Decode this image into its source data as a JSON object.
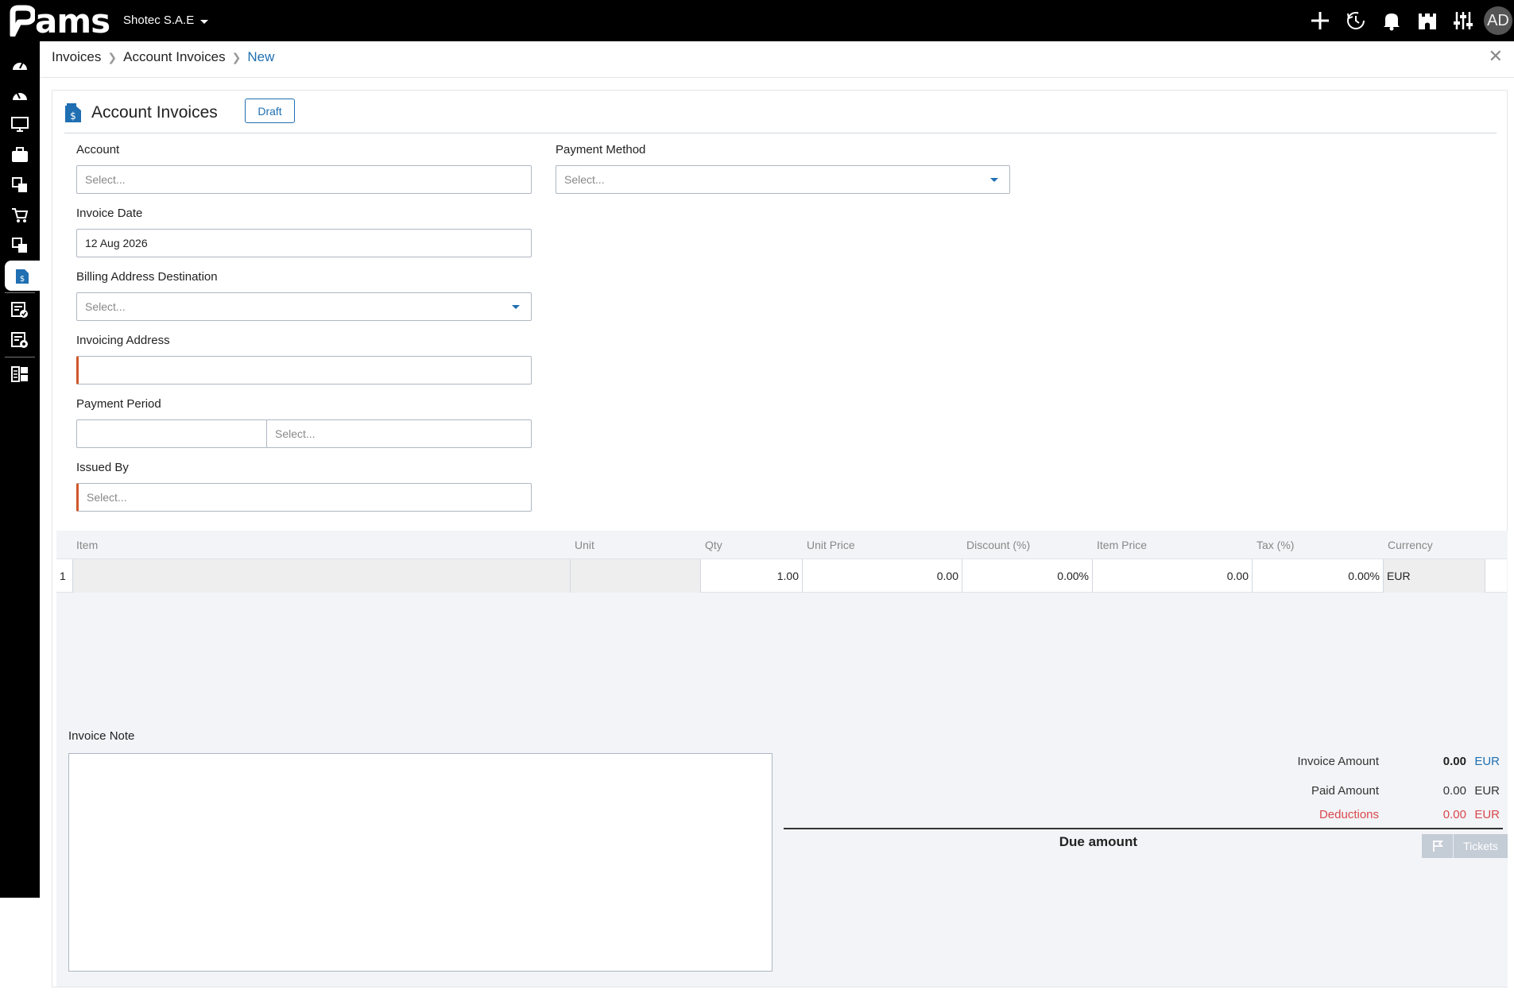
{
  "app": {
    "logo_text": "ams",
    "company": "Shotec S.A.E",
    "avatar_initials": "AD"
  },
  "topbar": {
    "icons": [
      "plus-icon",
      "history-icon",
      "bell-icon",
      "castle-icon",
      "sliders-icon"
    ]
  },
  "sidebar": {
    "items": [
      "dashboard-icon",
      "dashboard-alt-icon",
      "monitor-icon",
      "briefcase-icon",
      "documents-icon",
      "cart-icon",
      "documents-alt-icon",
      "invoice-icon",
      "checklist-icon",
      "settings-doc-icon",
      "grid-icon"
    ],
    "active_index": 7
  },
  "breadcrumb": {
    "items": [
      "Invoices",
      "Account Invoices",
      "New"
    ]
  },
  "form": {
    "title": "Account Invoices",
    "status": "Draft",
    "account": {
      "label": "Account",
      "placeholder": "Select..."
    },
    "payment_method": {
      "label": "Payment Method",
      "placeholder": "Select..."
    },
    "invoice_date": {
      "label": "Invoice Date",
      "value": "12 Aug 2026"
    },
    "billing_address": {
      "label": "Billing Address Destination",
      "placeholder": "Select..."
    },
    "invoicing_address": {
      "label": "Invoicing Address",
      "value": ""
    },
    "payment_period": {
      "label": "Payment Period",
      "value": "",
      "unit_placeholder": "Select..."
    },
    "issued_by": {
      "label": "Issued By",
      "placeholder": "Select..."
    }
  },
  "grid": {
    "headers": [
      "Item",
      "Unit",
      "Qty",
      "Unit Price",
      "Discount (%)",
      "Item Price",
      "Tax (%)",
      "Currency"
    ],
    "rows": [
      {
        "index": "1",
        "item": "",
        "unit": "",
        "qty": "1.00",
        "unit_price": "0.00",
        "discount": "0.00%",
        "item_price": "0.00",
        "tax": "0.00%",
        "currency": "EUR"
      }
    ]
  },
  "note": {
    "label": "Invoice Note",
    "value": ""
  },
  "summary": {
    "invoice_amount": {
      "label": "Invoice Amount",
      "value": "0.00",
      "currency": "EUR"
    },
    "paid_amount": {
      "label": "Paid Amount",
      "value": "0.00",
      "currency": "EUR"
    },
    "deductions": {
      "label": "Deductions",
      "value": "0.00",
      "currency": "EUR"
    },
    "due_label": "Due amount",
    "tickets_label": "Tickets"
  },
  "colors": {
    "accent": "#1f6fb2",
    "required": "#d0572a",
    "deduction": "#d9484d"
  }
}
